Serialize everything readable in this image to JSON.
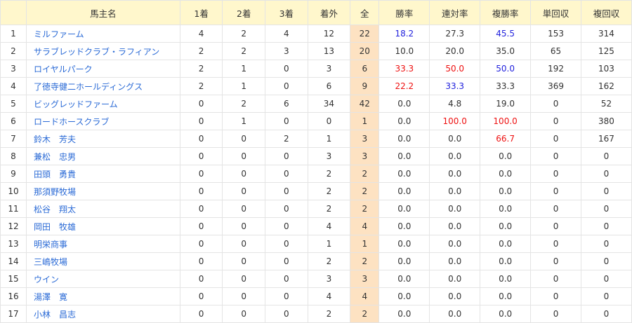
{
  "headers": [
    "",
    "馬主名",
    "1着",
    "2着",
    "3着",
    "着外",
    "全",
    "勝率",
    "連対率",
    "複勝率",
    "単回収",
    "複回収"
  ],
  "colors": {
    "red": "#ee1111",
    "blue": "#2222dd",
    "link": "#2a6ad6",
    "header_bg": "#fff7cc",
    "all_bg": "#fde2c2"
  },
  "rows": [
    {
      "no": "1",
      "name": "ミルファーム",
      "c1": "4",
      "c2": "2",
      "c3": "4",
      "out": "12",
      "all": "22",
      "win": "18.2",
      "win_c": "blue",
      "ren": "27.3",
      "ren_c": "",
      "fuku": "45.5",
      "fuku_c": "blue",
      "tan": "153",
      "fukuk": "314"
    },
    {
      "no": "2",
      "name": "サラブレッドクラブ・ラフィアン",
      "c1": "2",
      "c2": "2",
      "c3": "3",
      "out": "13",
      "all": "20",
      "win": "10.0",
      "win_c": "",
      "ren": "20.0",
      "ren_c": "",
      "fuku": "35.0",
      "fuku_c": "",
      "tan": "65",
      "fukuk": "125"
    },
    {
      "no": "3",
      "name": "ロイヤルパーク",
      "c1": "2",
      "c2": "1",
      "c3": "0",
      "out": "3",
      "all": "6",
      "win": "33.3",
      "win_c": "red",
      "ren": "50.0",
      "ren_c": "red",
      "fuku": "50.0",
      "fuku_c": "blue",
      "tan": "192",
      "fukuk": "103"
    },
    {
      "no": "4",
      "name": "了徳寺健二ホールディングス",
      "c1": "2",
      "c2": "1",
      "c3": "0",
      "out": "6",
      "all": "9",
      "win": "22.2",
      "win_c": "red",
      "ren": "33.3",
      "ren_c": "blue",
      "fuku": "33.3",
      "fuku_c": "",
      "tan": "369",
      "fukuk": "162"
    },
    {
      "no": "5",
      "name": "ビッグレッドファーム",
      "c1": "0",
      "c2": "2",
      "c3": "6",
      "out": "34",
      "all": "42",
      "win": "0.0",
      "win_c": "",
      "ren": "4.8",
      "ren_c": "",
      "fuku": "19.0",
      "fuku_c": "",
      "tan": "0",
      "fukuk": "52"
    },
    {
      "no": "6",
      "name": "ロードホースクラブ",
      "c1": "0",
      "c2": "1",
      "c3": "0",
      "out": "0",
      "all": "1",
      "win": "0.0",
      "win_c": "",
      "ren": "100.0",
      "ren_c": "red",
      "fuku": "100.0",
      "fuku_c": "red",
      "tan": "0",
      "fukuk": "380"
    },
    {
      "no": "7",
      "name": "鈴木　芳夫",
      "c1": "0",
      "c2": "0",
      "c3": "2",
      "out": "1",
      "all": "3",
      "win": "0.0",
      "win_c": "",
      "ren": "0.0",
      "ren_c": "",
      "fuku": "66.7",
      "fuku_c": "red",
      "tan": "0",
      "fukuk": "167"
    },
    {
      "no": "8",
      "name": "兼松　忠男",
      "c1": "0",
      "c2": "0",
      "c3": "0",
      "out": "3",
      "all": "3",
      "win": "0.0",
      "win_c": "",
      "ren": "0.0",
      "ren_c": "",
      "fuku": "0.0",
      "fuku_c": "",
      "tan": "0",
      "fukuk": "0"
    },
    {
      "no": "9",
      "name": "田頭　勇貴",
      "c1": "0",
      "c2": "0",
      "c3": "0",
      "out": "2",
      "all": "2",
      "win": "0.0",
      "win_c": "",
      "ren": "0.0",
      "ren_c": "",
      "fuku": "0.0",
      "fuku_c": "",
      "tan": "0",
      "fukuk": "0"
    },
    {
      "no": "10",
      "name": "那須野牧場",
      "c1": "0",
      "c2": "0",
      "c3": "0",
      "out": "2",
      "all": "2",
      "win": "0.0",
      "win_c": "",
      "ren": "0.0",
      "ren_c": "",
      "fuku": "0.0",
      "fuku_c": "",
      "tan": "0",
      "fukuk": "0"
    },
    {
      "no": "11",
      "name": "松谷　翔太",
      "c1": "0",
      "c2": "0",
      "c3": "0",
      "out": "2",
      "all": "2",
      "win": "0.0",
      "win_c": "",
      "ren": "0.0",
      "ren_c": "",
      "fuku": "0.0",
      "fuku_c": "",
      "tan": "0",
      "fukuk": "0"
    },
    {
      "no": "12",
      "name": "岡田　牧雄",
      "c1": "0",
      "c2": "0",
      "c3": "0",
      "out": "4",
      "all": "4",
      "win": "0.0",
      "win_c": "",
      "ren": "0.0",
      "ren_c": "",
      "fuku": "0.0",
      "fuku_c": "",
      "tan": "0",
      "fukuk": "0"
    },
    {
      "no": "13",
      "name": "明栄商事",
      "c1": "0",
      "c2": "0",
      "c3": "0",
      "out": "1",
      "all": "1",
      "win": "0.0",
      "win_c": "",
      "ren": "0.0",
      "ren_c": "",
      "fuku": "0.0",
      "fuku_c": "",
      "tan": "0",
      "fukuk": "0"
    },
    {
      "no": "14",
      "name": "三嶋牧場",
      "c1": "0",
      "c2": "0",
      "c3": "0",
      "out": "2",
      "all": "2",
      "win": "0.0",
      "win_c": "",
      "ren": "0.0",
      "ren_c": "",
      "fuku": "0.0",
      "fuku_c": "",
      "tan": "0",
      "fukuk": "0"
    },
    {
      "no": "15",
      "name": "ウイン",
      "c1": "0",
      "c2": "0",
      "c3": "0",
      "out": "3",
      "all": "3",
      "win": "0.0",
      "win_c": "",
      "ren": "0.0",
      "ren_c": "",
      "fuku": "0.0",
      "fuku_c": "",
      "tan": "0",
      "fukuk": "0"
    },
    {
      "no": "16",
      "name": "湯澤　寛",
      "c1": "0",
      "c2": "0",
      "c3": "0",
      "out": "4",
      "all": "4",
      "win": "0.0",
      "win_c": "",
      "ren": "0.0",
      "ren_c": "",
      "fuku": "0.0",
      "fuku_c": "",
      "tan": "0",
      "fukuk": "0"
    },
    {
      "no": "17",
      "name": "小林　昌志",
      "c1": "0",
      "c2": "0",
      "c3": "0",
      "out": "2",
      "all": "2",
      "win": "0.0",
      "win_c": "",
      "ren": "0.0",
      "ren_c": "",
      "fuku": "0.0",
      "fuku_c": "",
      "tan": "0",
      "fukuk": "0"
    }
  ]
}
